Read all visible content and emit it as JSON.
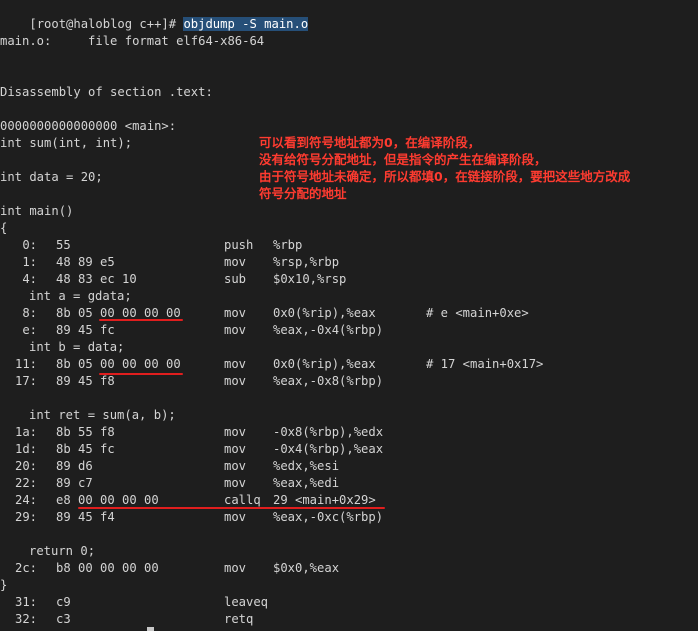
{
  "prompt": "[root@haloblog c++]# ",
  "command": "objdump -S main.o",
  "file_format": "main.o:     file format elf64-x86-64",
  "section": "Disassembly of section .text:",
  "symbol": "0000000000000000 <main>:",
  "src1": "int sum(int, int);",
  "src2": "int data = 20;",
  "src3": "int main()",
  "src4": "{",
  "asm": [
    {
      "addr": "0:",
      "bytes": "55",
      "mn": "push",
      "op": "%rbp",
      "cm": ""
    },
    {
      "addr": "1:",
      "bytes": "48 89 e5",
      "mn": "mov",
      "op": "%rsp,%rbp",
      "cm": ""
    },
    {
      "addr": "4:",
      "bytes": "48 83 ec 10",
      "mn": "sub",
      "op": "$0x10,%rsp",
      "cm": ""
    },
    {
      "src": "int a = gdata;"
    },
    {
      "addr": "8:",
      "bytes": "8b 05 00 00 00 00",
      "mn": "mov",
      "op": "0x0(%rip),%eax",
      "cm": "# e <main+0xe>"
    },
    {
      "addr": "e:",
      "bytes": "89 45 fc",
      "mn": "mov",
      "op": "%eax,-0x4(%rbp)",
      "cm": ""
    },
    {
      "src": "int b = data;"
    },
    {
      "addr": "11:",
      "bytes": "8b 05 00 00 00 00",
      "mn": "mov",
      "op": "0x0(%rip),%eax",
      "cm": "# 17 <main+0x17>"
    },
    {
      "addr": "17:",
      "bytes": "89 45 f8",
      "mn": "mov",
      "op": "%eax,-0x8(%rbp)",
      "cm": ""
    },
    {
      "blank": true
    },
    {
      "src": "int ret = sum(a, b);"
    },
    {
      "addr": "1a:",
      "bytes": "8b 55 f8",
      "mn": "mov",
      "op": "-0x8(%rbp),%edx",
      "cm": ""
    },
    {
      "addr": "1d:",
      "bytes": "8b 45 fc",
      "mn": "mov",
      "op": "-0x4(%rbp),%eax",
      "cm": ""
    },
    {
      "addr": "20:",
      "bytes": "89 d6",
      "mn": "mov",
      "op": "%edx,%esi",
      "cm": ""
    },
    {
      "addr": "22:",
      "bytes": "89 c7",
      "mn": "mov",
      "op": "%eax,%edi",
      "cm": ""
    },
    {
      "addr": "24:",
      "bytes": "e8 00 00 00 00",
      "mn": "callq",
      "op": "29 <main+0x29>",
      "cm": ""
    },
    {
      "addr": "29:",
      "bytes": "89 45 f4",
      "mn": "mov",
      "op": "%eax,-0xc(%rbp)",
      "cm": ""
    },
    {
      "blank": true
    },
    {
      "src": "return 0;"
    },
    {
      "addr": "2c:",
      "bytes": "b8 00 00 00 00",
      "mn": "mov",
      "op": "$0x0,%eax",
      "cm": ""
    },
    {
      "brace": "}"
    },
    {
      "addr": "31:",
      "bytes": "c9",
      "mn": "leaveq",
      "op": "",
      "cm": ""
    },
    {
      "addr": "32:",
      "bytes": "c3",
      "mn": "retq",
      "op": "",
      "cm": ""
    }
  ],
  "annotation": [
    "可以看到符号地址都为0，在编译阶段，",
    "没有给符号分配地址，但是指令的产生在编译阶段，",
    "由于符号地址未确定，所以都填0，在链接阶段，要把这些地方改成",
    "符号分配的地址"
  ],
  "colors": {
    "annotation": "#ff3b30",
    "underline": "#e01e1e",
    "selection": "#264f78"
  }
}
